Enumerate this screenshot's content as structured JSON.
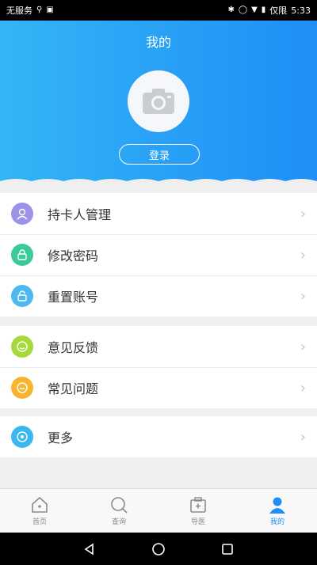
{
  "status_bar": {
    "carrier": "无服务",
    "time": "5:33",
    "carrier_right": "仅限"
  },
  "header": {
    "title": "我的",
    "login_label": "登录"
  },
  "menu_groups": [
    [
      {
        "label": "持卡人管理",
        "icon": "user-icon",
        "color": "#9c93e8"
      },
      {
        "label": "修改密码",
        "icon": "lock-icon",
        "color": "#3cc99a"
      },
      {
        "label": "重置账号",
        "icon": "reset-icon",
        "color": "#4fb8f0"
      }
    ],
    [
      {
        "label": "意见反馈",
        "icon": "feedback-icon",
        "color": "#a6d93a"
      },
      {
        "label": "常见问题",
        "icon": "question-icon",
        "color": "#f7b52f"
      }
    ],
    [
      {
        "label": "更多",
        "icon": "more-icon",
        "color": "#3bb6ee"
      }
    ]
  ],
  "tabs": [
    {
      "label": "首页",
      "icon": "home-icon",
      "active": false
    },
    {
      "label": "查询",
      "icon": "search-icon",
      "active": false
    },
    {
      "label": "导医",
      "icon": "medical-icon",
      "active": false
    },
    {
      "label": "我的",
      "icon": "profile-icon",
      "active": true
    }
  ],
  "colors": {
    "accent": "#1f8ef6",
    "header_start": "#33b5f6",
    "header_end": "#1f8ef6"
  }
}
